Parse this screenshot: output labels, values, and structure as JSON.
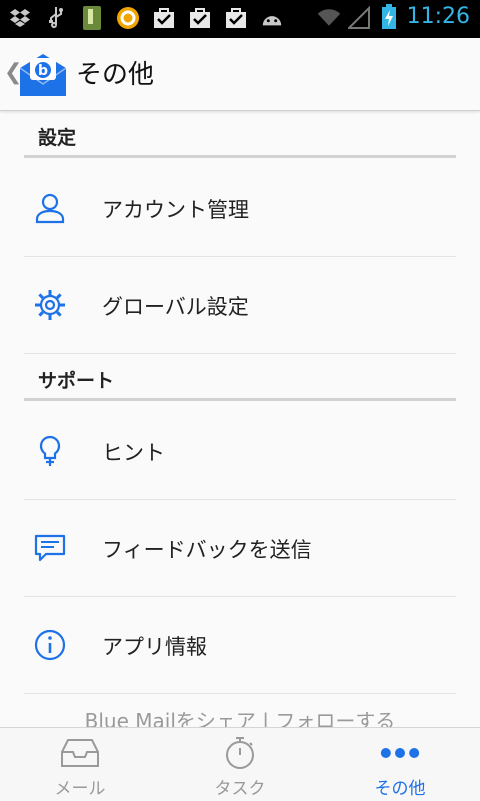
{
  "status_bar": {
    "time": "11:26",
    "icons": [
      "dropbox-icon",
      "usb-icon",
      "sd-card-icon",
      "notification-icon",
      "download-check-icon",
      "download-check-icon",
      "download-check-icon",
      "android-icon",
      "wifi-icon",
      "signal-icon",
      "battery-charging-icon"
    ]
  },
  "action_bar": {
    "title": "その他"
  },
  "sections": {
    "settings": {
      "header": "設定",
      "items": [
        {
          "label": "アカウント管理",
          "icon": "person-icon"
        },
        {
          "label": "グローバル設定",
          "icon": "gear-icon"
        }
      ]
    },
    "support": {
      "header": "サポート",
      "items": [
        {
          "label": "ヒント",
          "icon": "lightbulb-icon"
        },
        {
          "label": "フィードバックを送信",
          "icon": "chat-icon"
        },
        {
          "label": "アプリ情報",
          "icon": "info-icon"
        }
      ]
    }
  },
  "share_text": "Blue Mailをシェア | フォローする",
  "bottom_nav": {
    "items": [
      {
        "label": "メール",
        "icon": "inbox-icon",
        "active": false
      },
      {
        "label": "タスク",
        "icon": "stopwatch-icon",
        "active": false
      },
      {
        "label": "その他",
        "icon": "more-dots-icon",
        "active": true
      }
    ]
  },
  "colors": {
    "accent": "#1e72e8",
    "status_time": "#33b5e5"
  }
}
